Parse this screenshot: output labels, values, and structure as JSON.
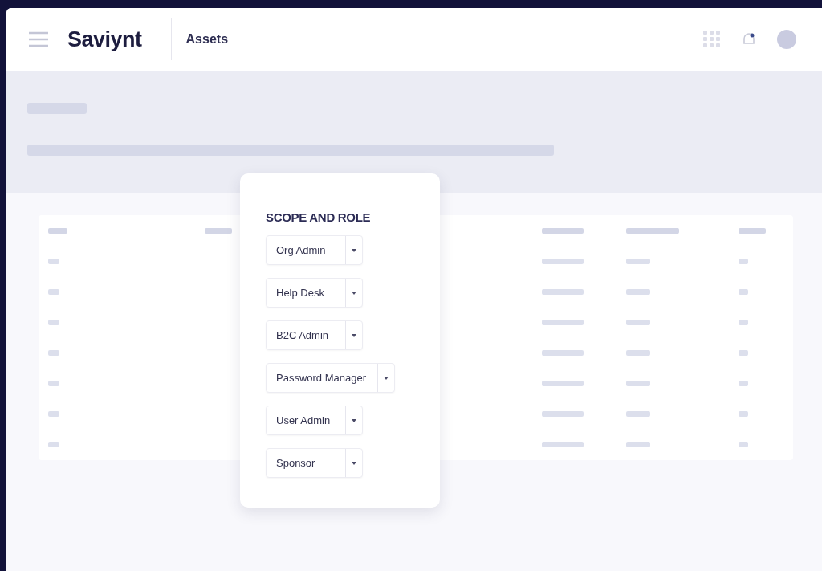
{
  "header": {
    "logo": "Saviynt",
    "title": "Assets"
  },
  "popover": {
    "title": "SCOPE AND ROLE",
    "roles": [
      {
        "label": "Org Admin"
      },
      {
        "label": "Help Desk"
      },
      {
        "label": "B2C Admin"
      },
      {
        "label": "Password Manager"
      },
      {
        "label": "User Admin"
      },
      {
        "label": "Sponsor"
      }
    ]
  }
}
